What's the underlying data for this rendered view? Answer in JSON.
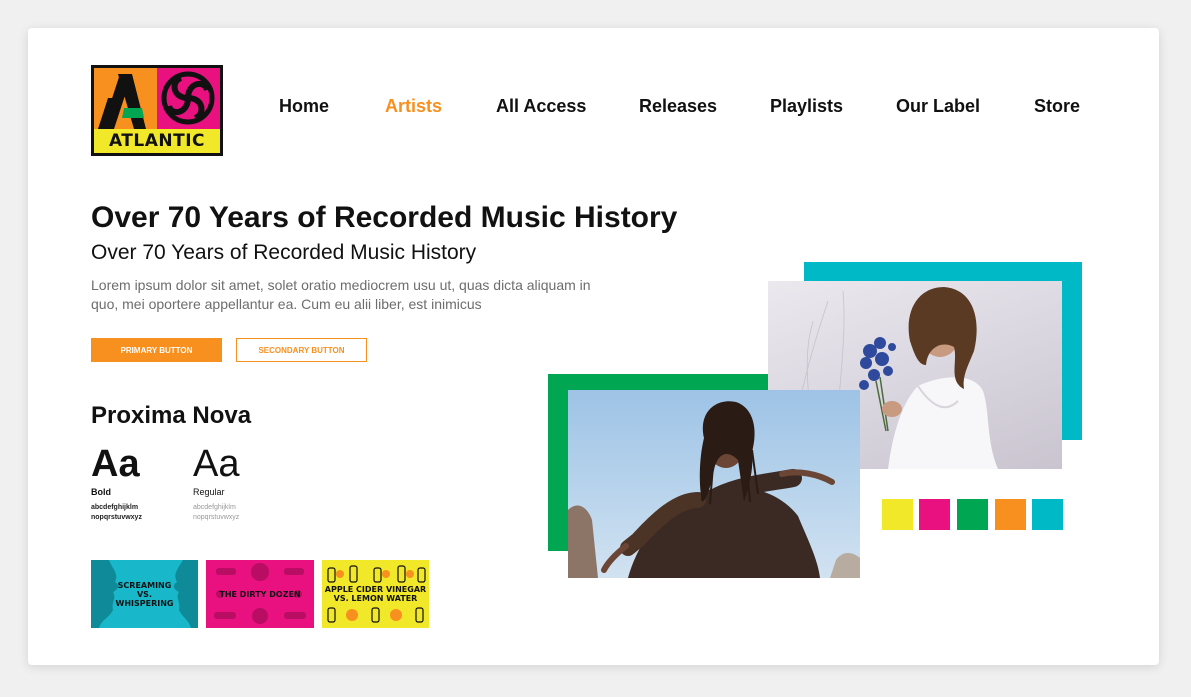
{
  "brand": {
    "logo_text": "ATLANTIC",
    "logo_colors": [
      "#f7901e",
      "#e8117f",
      "#f0e829",
      "#111111"
    ]
  },
  "nav": {
    "items": [
      {
        "label": "Home",
        "active": false
      },
      {
        "label": "Artists",
        "active": true
      },
      {
        "label": "All Access",
        "active": false
      },
      {
        "label": "Releases",
        "active": false
      },
      {
        "label": "Playlists",
        "active": false
      },
      {
        "label": "Our Label",
        "active": false
      },
      {
        "label": "Store",
        "active": false
      }
    ],
    "active_color": "#f7901e"
  },
  "hero": {
    "heading": "Over 70 Years of Recorded Music History",
    "subheading": "Over 70 Years of Recorded Music History",
    "body": "Lorem ipsum dolor sit amet, solet oratio mediocrem usu ut, quas dicta aliquam in quo, mei oportere appellantur ea. Cum eu alii liber, est inimicus",
    "primary_button": "PRIMARY BUTTON",
    "secondary_button": "SECONDARY BUTTON"
  },
  "typography": {
    "font_name": "Proxima Nova",
    "sample": "Aa",
    "weights": [
      {
        "label": "Bold",
        "alphabet_line1": "abcdefghijklm",
        "alphabet_line2": "nopqrstuvwxyz"
      },
      {
        "label": "Regular",
        "alphabet_line1": "abcdefghijklm",
        "alphabet_line2": "nopqrstuvwxyz"
      }
    ]
  },
  "tiles": [
    {
      "line1": "SCREAMING",
      "line2": "VS.",
      "line3": "WHISPERING",
      "color": "#18b7c9"
    },
    {
      "line1": "THE DIRTY DOZEN",
      "color": "#e8117f"
    },
    {
      "line1": "APPLE CIDER VINEGAR",
      "line2": "VS. LEMON WATER",
      "color": "#f0e829"
    }
  ],
  "collage": {
    "green_block": "#00a651",
    "teal_block": "#00b9c6"
  },
  "palette": [
    "#f0e829",
    "#e8117f",
    "#00a651",
    "#f7901e",
    "#00b9c6"
  ]
}
